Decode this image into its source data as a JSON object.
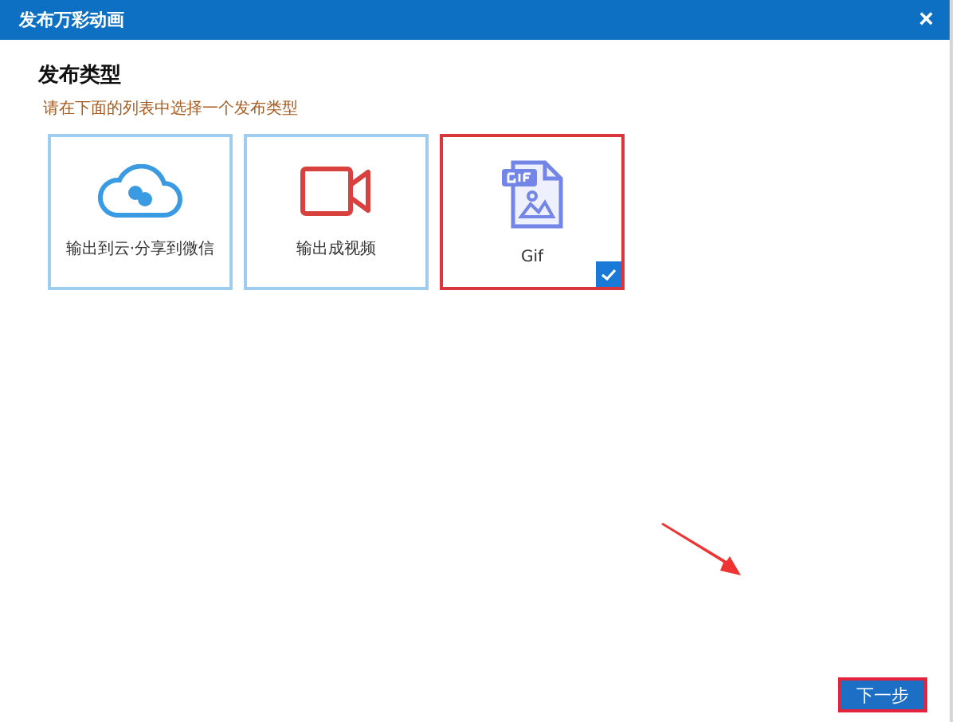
{
  "window": {
    "title": "发布万彩动画",
    "close": "×"
  },
  "section": {
    "heading": "发布类型",
    "hint": "请在下面的列表中选择一个发布类型"
  },
  "options": [
    {
      "label": "输出到云·分享到微信",
      "kind": "cloud",
      "selected": false
    },
    {
      "label": "输出成视频",
      "kind": "video",
      "selected": false
    },
    {
      "label": "Gif",
      "kind": "gif",
      "selected": true
    }
  ],
  "footer": {
    "button": "下一步",
    "highlighted": true
  }
}
